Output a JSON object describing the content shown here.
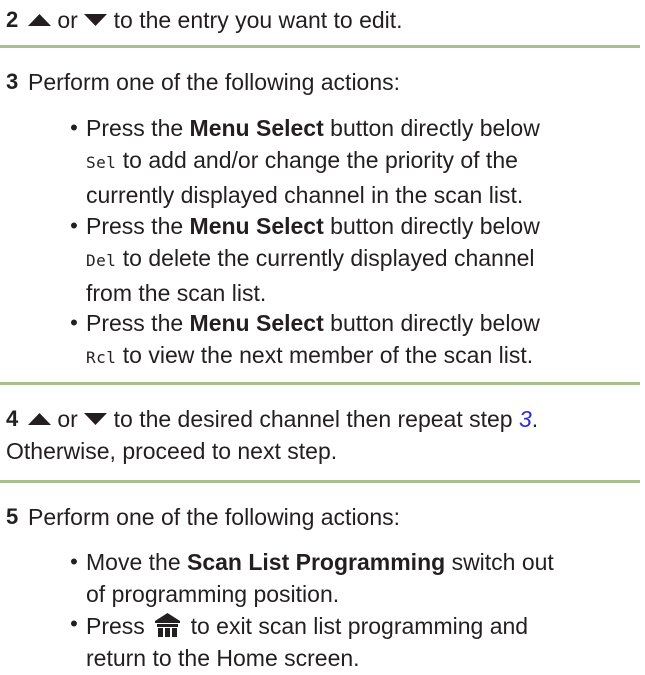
{
  "steps": [
    {
      "number": "2",
      "up_icon": "up-arrow-icon",
      "or": "or",
      "down_icon": "down-arrow-icon",
      "text": "to the entry you want to edit."
    },
    {
      "number": "3",
      "text": "Perform one of the following actions:",
      "bullets": [
        {
          "pre": "Press the",
          "button": "Menu Select",
          "mid": "button directly below",
          "code": "Sel",
          "line1_post": "to add and/or change the priority of the",
          "line2": "currently displayed channel in the scan list."
        },
        {
          "pre": "Press the",
          "button": "Menu Select",
          "mid": "button directly below",
          "code": "Del",
          "line1_post": "to delete the currently displayed channel",
          "line2": "from the scan list."
        },
        {
          "pre": "Press the",
          "button": "Menu Select",
          "mid": "button directly below",
          "code": "Rcl",
          "line1_post": "to view the next member of the scan list."
        }
      ]
    },
    {
      "number": "4",
      "or": "or",
      "text": "to the desired channel then repeat step",
      "ref": "3",
      "period": ".",
      "line2": "Otherwise, proceed to next step."
    },
    {
      "number": "5",
      "text": "Perform one of the following actions:",
      "bullets": [
        {
          "pre": "Move the",
          "button": "Scan List Programming",
          "post": "switch out",
          "line2": "of programming position."
        },
        {
          "pre": "Press",
          "icon": "home-icon",
          "post": "to exit scan list programming and",
          "line2": "return to the Home screen."
        }
      ]
    }
  ],
  "bullet_char": "•",
  "colors": {
    "rule": "#a9bf8c",
    "reference_link": "#2d2fd6",
    "text": "#231f20"
  }
}
